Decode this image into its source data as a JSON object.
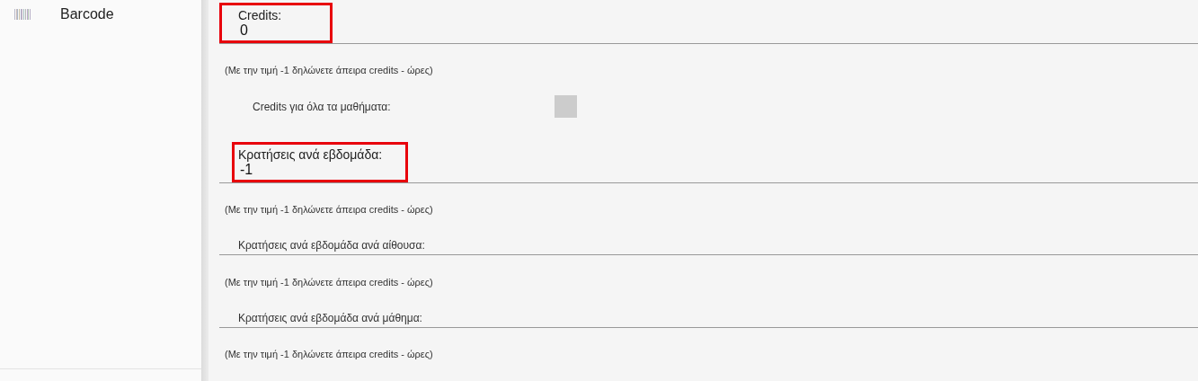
{
  "sidebar": {
    "items": [
      {
        "label": "Barcode"
      }
    ]
  },
  "form": {
    "rows": [
      {
        "kind": "field",
        "label": "Credits:",
        "value": "0",
        "highlighted": true
      },
      {
        "kind": "hint",
        "text": "(Με την τιμή -1 δηλώνετε άπειρα credits - ώρες)"
      },
      {
        "kind": "checkbox",
        "label": "Credits για όλα τα μαθήματα:",
        "checked": false
      },
      {
        "kind": "field",
        "label": "Κρατήσεις ανά εβδομάδα:",
        "value": "-1",
        "highlighted": true
      },
      {
        "kind": "hint",
        "text": "(Με την τιμή -1 δηλώνετε άπειρα credits - ώρες)"
      },
      {
        "kind": "field",
        "label": "Κρατήσεις ανά εβδομάδα ανά αίθουσα:",
        "highlighted": false
      },
      {
        "kind": "hint",
        "text": "(Με την τιμή -1 δηλώνετε άπειρα credits - ώρες)"
      },
      {
        "kind": "field",
        "label": "Κρατήσεις ανά εβδομάδα ανά μάθημα:",
        "highlighted": false
      },
      {
        "kind": "hint",
        "text": "(Με την τιμή -1 δηλώνετε άπειρα credits - ώρες)"
      }
    ]
  }
}
